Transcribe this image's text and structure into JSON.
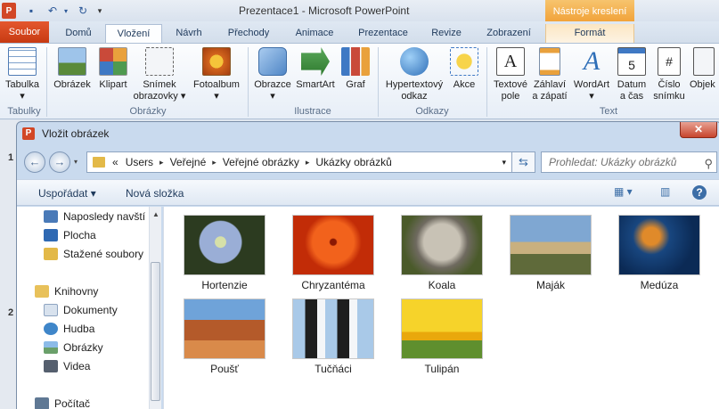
{
  "app": {
    "title": "Prezentace1  -  Microsoft PowerPoint",
    "contextual_tab_group": "Nástroje kreslení"
  },
  "tabs": [
    {
      "label": "Soubor"
    },
    {
      "label": "Domů"
    },
    {
      "label": "Vložení"
    },
    {
      "label": "Návrh"
    },
    {
      "label": "Přechody"
    },
    {
      "label": "Animace"
    },
    {
      "label": "Prezentace"
    },
    {
      "label": "Revize"
    },
    {
      "label": "Zobrazení"
    },
    {
      "label": "Formát"
    }
  ],
  "ribbon": {
    "groups": [
      {
        "label": "Tabulky"
      },
      {
        "label": "Obrázky"
      },
      {
        "label": "Ilustrace"
      },
      {
        "label": "Odkazy"
      },
      {
        "label": "Text"
      }
    ],
    "buttons": [
      {
        "line1": "Tabulka",
        "line2": "▾"
      },
      {
        "line1": "Obrázek",
        "line2": ""
      },
      {
        "line1": "Klipart",
        "line2": ""
      },
      {
        "line1": "Snímek",
        "line2": "obrazovky ▾"
      },
      {
        "line1": "Fotoalbum",
        "line2": "▾"
      },
      {
        "line1": "Obrazce",
        "line2": "▾"
      },
      {
        "line1": "SmartArt",
        "line2": ""
      },
      {
        "line1": "Graf",
        "line2": ""
      },
      {
        "line1": "Hypertextový",
        "line2": "odkaz"
      },
      {
        "line1": "Akce",
        "line2": ""
      },
      {
        "line1": "Textové",
        "line2": "pole"
      },
      {
        "line1": "Záhlaví",
        "line2": "a zápatí"
      },
      {
        "line1": "WordArt",
        "line2": "▾"
      },
      {
        "line1": "Datum",
        "line2": "a čas"
      },
      {
        "line1": "Číslo",
        "line2": "snímku"
      },
      {
        "line1": "Objek",
        "line2": ""
      }
    ],
    "date_icon_number": "5",
    "number_icon_symbol": "#"
  },
  "doc_strip": {
    "slide_numbers": [
      "1",
      "2"
    ]
  },
  "dialog": {
    "title": "Vložit obrázek",
    "icon_letter": "P",
    "close_symbol": "✕",
    "address": {
      "prefix": "«",
      "segments": [
        "Users",
        "Veřejné",
        "Veřejné obrázky",
        "Ukázky obrázků"
      ]
    },
    "search_placeholder": "Prohledat: Ukázky obrázků",
    "commands": {
      "organize": "Uspořádat ▾",
      "new_folder": "Nová složka"
    },
    "nav_items": [
      {
        "label": "Naposledy navští",
        "icon": "recent-places-icon",
        "color": "#4a7ab8",
        "group": "favorites"
      },
      {
        "label": "Plocha",
        "icon": "desktop-icon",
        "color": "#2f69b3",
        "group": "favorites"
      },
      {
        "label": "Stažené soubory",
        "icon": "downloads-folder-icon",
        "color": "#e3b948",
        "group": "favorites"
      },
      {
        "label": "Knihovny",
        "icon": "libraries-icon",
        "color": "#e8c15a",
        "group": "top"
      },
      {
        "label": "Dokumenty",
        "icon": "documents-icon",
        "color": "#d8e2ee",
        "group": "libraries"
      },
      {
        "label": "Hudba",
        "icon": "music-icon",
        "color": "#3f86c9",
        "group": "libraries"
      },
      {
        "label": "Obrázky",
        "icon": "pictures-icon",
        "color": "#6aa06a",
        "group": "libraries"
      },
      {
        "label": "Videa",
        "icon": "videos-icon",
        "color": "#555f6e",
        "group": "libraries"
      },
      {
        "label": "Počítač",
        "icon": "computer-icon",
        "color": "#5f7894",
        "group": "top"
      }
    ],
    "files": [
      {
        "name": "Hortenzie",
        "colors": [
          "#2c3b20",
          "#9aaed6",
          "#d6e0a8"
        ]
      },
      {
        "name": "Chryzantéma",
        "colors": [
          "#c22c07",
          "#f2621c",
          "#8a1803"
        ]
      },
      {
        "name": "Koala",
        "colors": [
          "#6f6a60",
          "#c8c2b5",
          "#4a5a2a"
        ]
      },
      {
        "name": "Maják",
        "colors": [
          "#7fa7d2",
          "#5f6a3a",
          "#c9b07f"
        ]
      },
      {
        "name": "Medúza",
        "colors": [
          "#0b2a55",
          "#e08a2a",
          "#18467f"
        ]
      },
      {
        "name": "Poušť",
        "colors": [
          "#6fa3d9",
          "#b45a2a",
          "#d98a4a"
        ]
      },
      {
        "name": "Tučňáci",
        "colors": [
          "#a9c9e8",
          "#1e1e1e",
          "#f4f6f8"
        ]
      },
      {
        "name": "Tulipán",
        "colors": [
          "#f6d32a",
          "#5f8f2e",
          "#e9a80c"
        ]
      }
    ]
  }
}
